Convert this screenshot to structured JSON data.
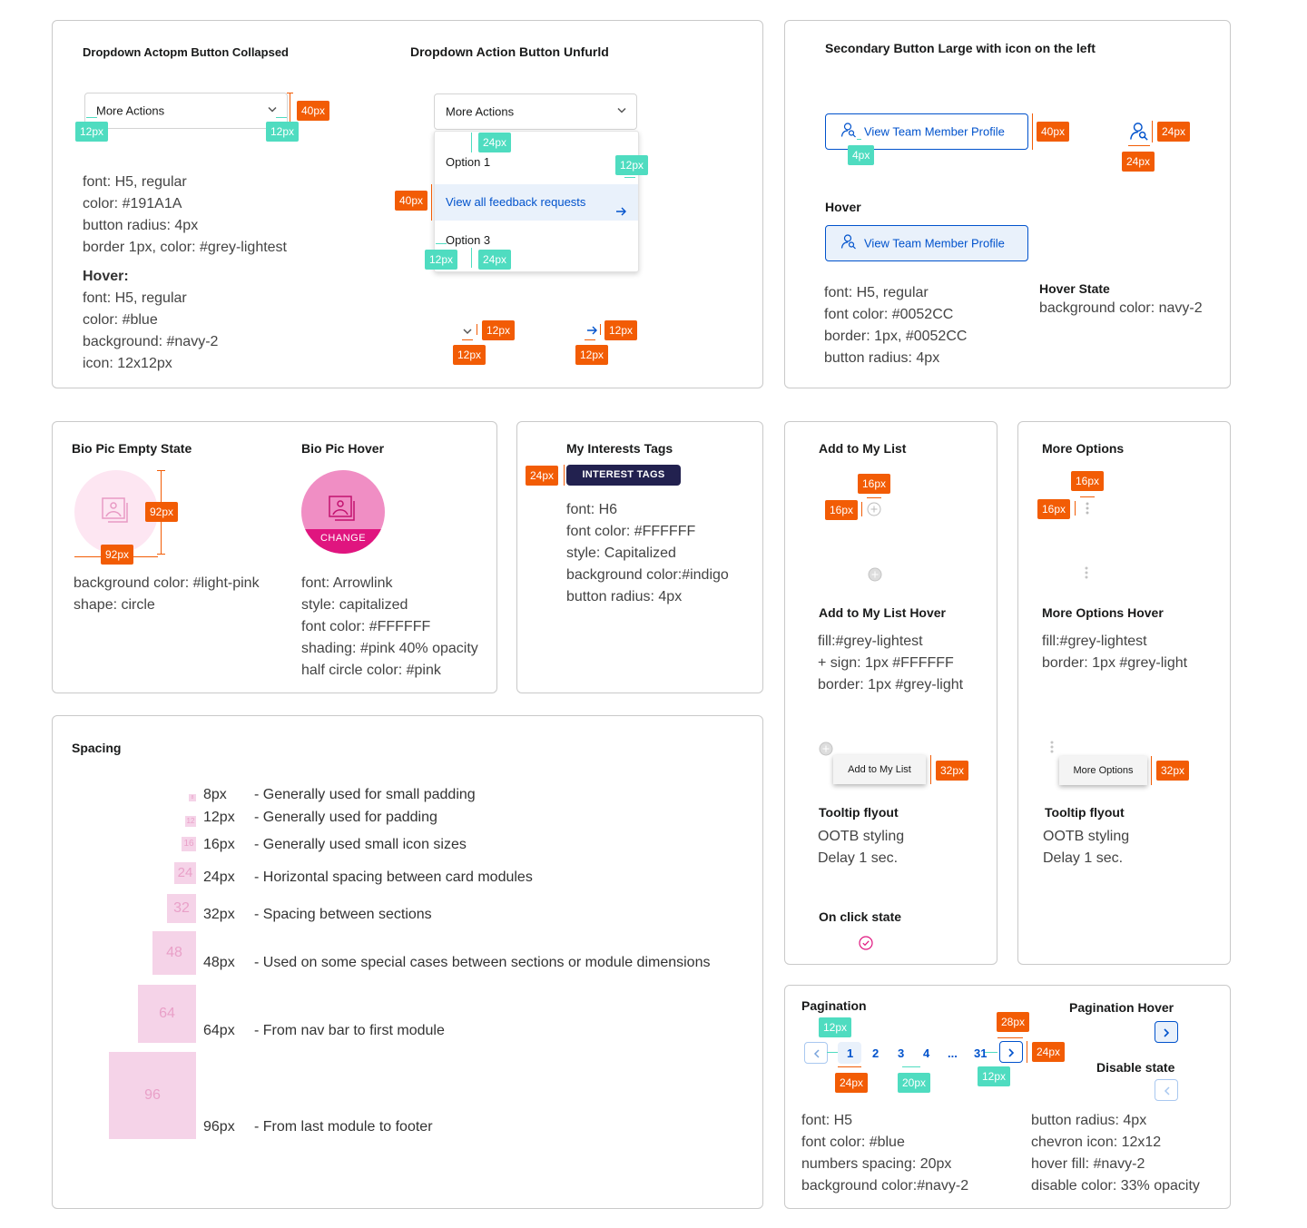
{
  "dropdown_section": {
    "title_collapsed": "Dropdown Actopm Button Collapsed",
    "title_unfurled": "Dropdown Action Button Unfurld",
    "button_label": "More Actions",
    "options": [
      "Option 1",
      "View all feedback requests",
      "Option 3"
    ],
    "specs": [
      "font: H5, regular",
      "color: #191A1A",
      "button radius: 4px",
      "border 1px, color: #grey-lightest"
    ],
    "hover_heading": "Hover:",
    "hover_specs": [
      "font: H5, regular",
      "color: #blue",
      "background: #navy-2",
      "icon: 12x12px"
    ],
    "measures": {
      "m40": "40px",
      "m12": "12px",
      "m24": "24px"
    }
  },
  "secondary_button_section": {
    "title": "Secondary Button Large with icon on the left",
    "button_label": "View Team Member Profile",
    "hover_heading": "Hover",
    "specs": [
      "font: H5, regular",
      "font color: #0052CC",
      "border: 1px, #0052CC",
      "button radius: 4px"
    ],
    "hover_state_heading": "Hover State",
    "hover_state_spec": "background color: navy-2",
    "measures": {
      "m40": "40px",
      "m4": "4px",
      "m24": "24px"
    }
  },
  "bio_pic_section": {
    "empty_title": "Bio Pic Empty State",
    "hover_title": "Bio Pic Hover",
    "change_label": "CHANGE",
    "empty_specs": [
      "background color: #light-pink",
      "shape: circle"
    ],
    "hover_specs": [
      "font: Arrowlink",
      "style: capitalized",
      "font color: #FFFFFF",
      "shading: #pink 40% opacity",
      "half circle color: #pink"
    ],
    "measure": "92px"
  },
  "interests_section": {
    "title": "My Interests Tags",
    "tag_label": "INTEREST TAGS",
    "measure": "24px",
    "specs": [
      "font: H6",
      "font color: #FFFFFF",
      "style: Capitalized",
      "background color:#indigo",
      "button radius: 4px"
    ]
  },
  "add_to_list_section": {
    "title": "Add to My List",
    "hover_title": "Add to My List Hover",
    "hover_specs": [
      "fill:#grey-lightest",
      "+ sign: 1px #FFFFFF",
      "border: 1px #grey-light"
    ],
    "tooltip_label": "Add to My List",
    "tooltip_heading": "Tooltip flyout",
    "tooltip_specs": [
      "OOTB styling",
      "Delay 1 sec."
    ],
    "on_click_heading": "On click state",
    "measures": {
      "m16": "16px",
      "m32": "32px"
    }
  },
  "more_options_section": {
    "title": "More Options",
    "hover_title": "More Options Hover",
    "hover_specs": [
      "fill:#grey-lightest",
      "border: 1px #grey-light"
    ],
    "tooltip_label": "More Options",
    "tooltip_heading": "Tooltip flyout",
    "tooltip_specs": [
      "OOTB styling",
      "Delay 1 sec."
    ],
    "measures": {
      "m16": "16px",
      "m32": "32px"
    }
  },
  "spacing_section": {
    "title": "Spacing",
    "rows": [
      {
        "num": "8",
        "value": "8px",
        "desc": "- Generally used for small padding"
      },
      {
        "num": "12",
        "value": "12px",
        "desc": "- Generally used for padding"
      },
      {
        "num": "16",
        "value": "16px",
        "desc": "- Generally used small icon sizes"
      },
      {
        "num": "24",
        "value": "24px",
        "desc": "- Horizontal spacing between card modules"
      },
      {
        "num": "32",
        "value": "32px",
        "desc": "- Spacing between sections"
      },
      {
        "num": "48",
        "value": "48px",
        "desc": "- Used on some special cases between sections or module dimensions"
      },
      {
        "num": "64",
        "value": "64px",
        "desc": "- From nav bar to first module"
      },
      {
        "num": "96",
        "value": "96px",
        "desc": "- From last module to footer"
      }
    ]
  },
  "pagination_section": {
    "title": "Pagination",
    "hover_title": "Pagination Hover",
    "disable_title": "Disable state",
    "pages": [
      "1",
      "2",
      "3",
      "4",
      "...",
      "31"
    ],
    "specs_left": [
      "font: H5",
      "font color: #blue",
      "numbers spacing: 20px",
      "background color:#navy-2"
    ],
    "specs_right": [
      "button radius: 4px",
      "chevron icon: 12x12",
      "hover fill: #navy-2",
      "disable color: 33% opacity"
    ],
    "measures": {
      "m12": "12px",
      "m24": "24px",
      "m20": "20px",
      "m28": "28px"
    }
  },
  "colors": {
    "orange": "#f25c05",
    "teal": "#4fdcc0",
    "blue": "#0052CC",
    "indigo": "#22214f",
    "pink": "#e0157f",
    "light_pink": "#fde6f2",
    "spacing_pink": "#f5d3e8"
  }
}
